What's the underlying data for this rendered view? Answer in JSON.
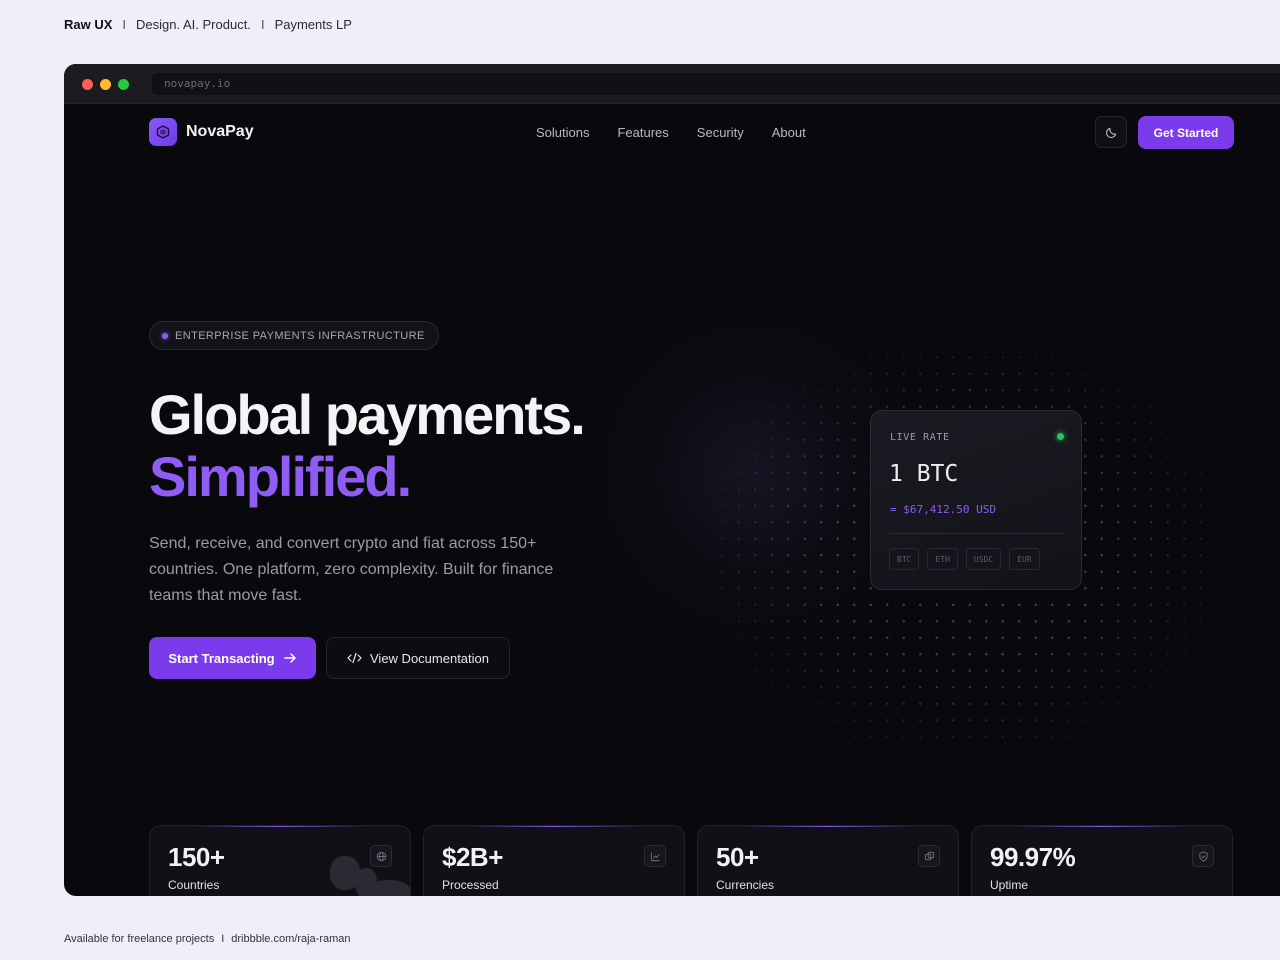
{
  "header": {
    "brand": "Raw UX",
    "separator": "I",
    "tagline": "Design. AI. Product.",
    "project": "Payments LP"
  },
  "footer": {
    "availability": "Available for freelance projects",
    "separator": "I",
    "link": "dribbble.com/raja-raman"
  },
  "browser": {
    "url": "novapay.io"
  },
  "nav": {
    "logo_text": "NovaPay",
    "links": [
      "Solutions",
      "Features",
      "Security",
      "About"
    ],
    "theme_icon": "moon-icon",
    "cta": "Get Started"
  },
  "hero": {
    "badge": "ENTERPRISE PAYMENTS INFRASTRUCTURE",
    "title_line1": "Global payments.",
    "title_line2": "Simplified.",
    "description": "Send, receive, and convert crypto and fiat across 150+ countries. One platform, zero complexity. Built for finance teams that move fast.",
    "primary_button": "Start Transacting",
    "secondary_button": "View Documentation"
  },
  "rate_card": {
    "label": "LIVE RATE",
    "amount": "1 BTC",
    "conversion": "= $67,412.50 USD",
    "currencies": [
      "BTC",
      "ETH",
      "USDC",
      "EUR"
    ]
  },
  "stats": [
    {
      "value": "150+",
      "label": "Countries",
      "icon": "globe-icon"
    },
    {
      "value": "$2B+",
      "label": "Processed",
      "icon": "chart-icon"
    },
    {
      "value": "50+",
      "label": "Currencies",
      "icon": "currency-icon"
    },
    {
      "value": "99.97%",
      "label": "Uptime",
      "icon": "shield-icon"
    }
  ],
  "colors": {
    "accent": "#7c3aed",
    "accent_text": "#8f5cf4",
    "background": "#09090d",
    "live": "#22c55e"
  }
}
